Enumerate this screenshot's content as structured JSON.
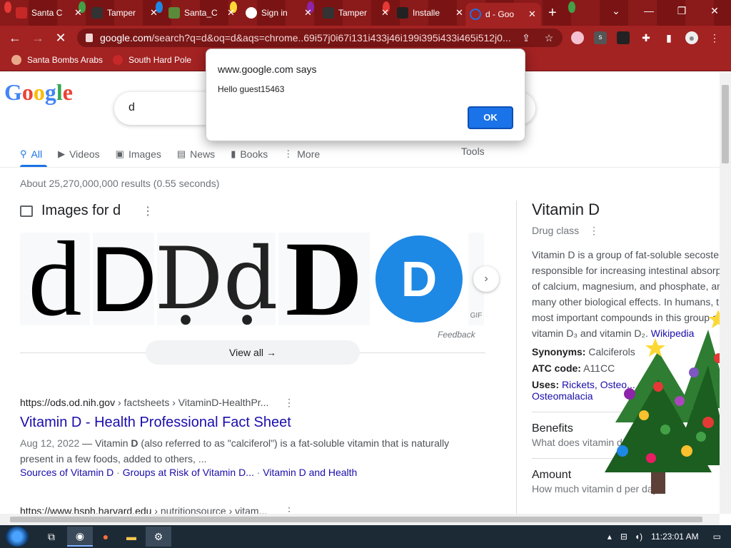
{
  "browser": {
    "tabs": [
      {
        "title": "Santa C",
        "favicon_color": "#c62828"
      },
      {
        "title": "Tamper",
        "favicon_color": "#333333"
      },
      {
        "title": "Santa_C",
        "favicon_color": "#5a8a3a"
      },
      {
        "title": "Sign in",
        "favicon_color": "#ffffff"
      },
      {
        "title": "Tamper",
        "favicon_color": "#333333"
      },
      {
        "title": "Installe",
        "favicon_color": "#222222"
      },
      {
        "title": "d - Goo",
        "favicon_color": "#1a73e8",
        "active": true
      }
    ],
    "url_host": "google.com",
    "url_rest": "/search?q=d&oq=d&aqs=chrome..69i57j0i67i131i433j46i199i395i433i465i512j0...",
    "bookmarks": [
      {
        "label": "Santa Bombs Arabs"
      },
      {
        "label": "South Hard Pole"
      }
    ]
  },
  "search": {
    "query": "d",
    "tabs": [
      {
        "label": "All",
        "icon": "search-icon",
        "glyph": "⚲"
      },
      {
        "label": "Videos",
        "icon": "video-icon",
        "glyph": "▶"
      },
      {
        "label": "Images",
        "icon": "image-icon",
        "glyph": "▣"
      },
      {
        "label": "News",
        "icon": "news-icon",
        "glyph": "▤"
      },
      {
        "label": "Books",
        "icon": "book-icon",
        "glyph": "▮"
      },
      {
        "label": "More",
        "icon": "more-icon",
        "glyph": "⋮"
      }
    ],
    "tools_label": "Tools",
    "stats": "About 25,270,000,000 results (0.55 seconds)"
  },
  "images": {
    "title": "Images for d",
    "feedback": "Feedback",
    "view_all": "View all",
    "thumb_letters": [
      "d",
      "D",
      "Ḍḍ",
      "D",
      "D"
    ],
    "gif_label": "GIF"
  },
  "results": [
    {
      "site": "https://ods.od.nih.gov",
      "path": " › factsheets › VitaminD-HealthPr...",
      "title": "Vitamin D - Health Professional Fact Sheet",
      "date": "Aug 12, 2022",
      "snippet_a": " — Vitamin ",
      "snippet_bold": "D",
      "snippet_b": " (also referred to as \"calciferol\") is a fat-soluble vitamin that is naturally present in a few foods, added to others, ...",
      "links": [
        "Sources of Vitamin D",
        "Groups at Risk of Vitamin D...",
        "Vitamin D and Health"
      ]
    },
    {
      "site": "https://www.hsph.harvard.edu",
      "path": " › nutritionsource › vitam..."
    }
  ],
  "knowledge_panel": {
    "title": "Vitamin D",
    "subtitle": "Drug class",
    "description": "Vitamin D is a group of fat-soluble secosteroids responsible for increasing intestinal absorption of calcium, magnesium, and phosphate, and many other biological effects. In humans, the most important compounds in this group are vitamin D₃ and vitamin D₂.",
    "wikipedia": "Wikipedia",
    "synonyms_label": "Synonyms:",
    "synonyms": "Calciferols",
    "atc_label": "ATC code:",
    "atc": "A11CC",
    "uses_label": "Uses:",
    "uses_1": "Rickets, Osteo...",
    "uses_2": "Osteomalacia",
    "benefits_heading": "Benefits",
    "benefits_sub": "What does vitamin d do?",
    "amount_heading": "Amount",
    "amount_sub": "How much vitamin d per day"
  },
  "dialog": {
    "heading": "www.google.com says",
    "message": "Hello guest15463",
    "ok_label": "OK"
  },
  "taskbar": {
    "clock": "11:23:01 AM"
  },
  "colors": {
    "chrome_theme": "#a32222",
    "google_blue": "#1a73e8",
    "link": "#1a0dab"
  }
}
